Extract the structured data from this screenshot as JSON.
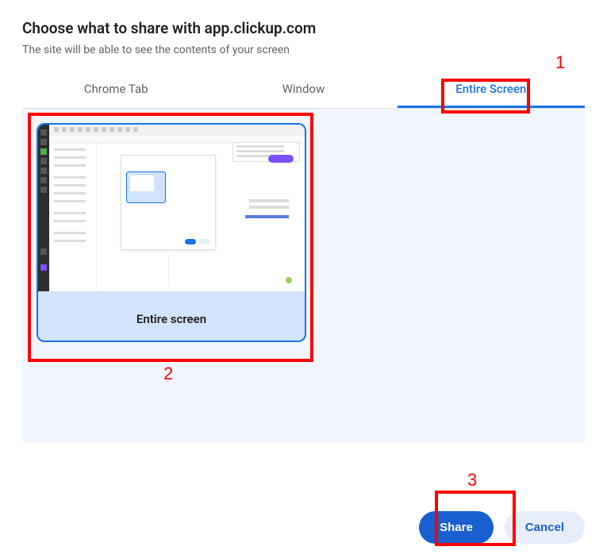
{
  "header": {
    "title": "Choose what to share with app.clickup.com",
    "subtitle": "The site will be able to see the contents of your screen"
  },
  "tabs": {
    "items": [
      {
        "label": "Chrome Tab"
      },
      {
        "label": "Window"
      },
      {
        "label": "Entire Screen"
      }
    ],
    "active_index": 2
  },
  "screens": {
    "selected_label": "Entire screen"
  },
  "footer": {
    "share_label": "Share",
    "cancel_label": "Cancel"
  },
  "annotations": {
    "step1": "1",
    "step2": "2",
    "step3": "3"
  },
  "colors": {
    "accent": "#1a73e8",
    "annotation": "#ff0000"
  }
}
